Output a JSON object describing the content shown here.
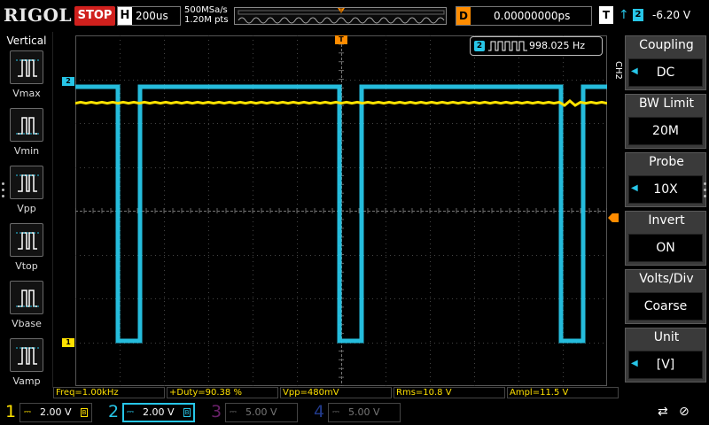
{
  "colors": {
    "ch1": "#ffe100",
    "ch2": "#27c6e8",
    "ch3": "#c03cc0",
    "ch4": "#3d6bff",
    "accent_stop": "#d0201d",
    "trigger_orange": "#ff8c00"
  },
  "topbar": {
    "brand": "RIGOL",
    "status": "STOP",
    "h_label": "H",
    "timebase": "200us",
    "sample_rate": "500MSa/s",
    "mem_depth": "1.20M pts",
    "delay_label": "D",
    "delay_value": "0.00000000ps",
    "trigger_label": "T",
    "trigger_edge_icon": "rising-edge-icon",
    "trigger_source": "2",
    "trigger_level": "-6.20 V"
  },
  "left_panel": {
    "title": "Vertical",
    "items": [
      {
        "label": "Vmax",
        "icon": "vmax-icon"
      },
      {
        "label": "Vmin",
        "icon": "vmin-icon"
      },
      {
        "label": "Vpp",
        "icon": "vpp-icon"
      },
      {
        "label": "Vtop",
        "icon": "vtop-icon"
      },
      {
        "label": "Vbase",
        "icon": "vbase-icon"
      },
      {
        "label": "Vamp",
        "icon": "vamp-icon"
      }
    ]
  },
  "freq_counter": {
    "channel": "2",
    "value": "998.025 Hz"
  },
  "markers": {
    "ch1": "1",
    "ch2": "2",
    "trigger_pos": "T"
  },
  "right_menu": {
    "channel_tag": "CH2",
    "items": [
      {
        "title": "Coupling",
        "value": "DC",
        "has_arrow": true
      },
      {
        "title": "BW Limit",
        "value": "20M",
        "has_arrow": false
      },
      {
        "title": "Probe",
        "value": "10X",
        "has_arrow": true
      },
      {
        "title": "Invert",
        "value": "ON",
        "has_arrow": false
      },
      {
        "title": "Volts/Div",
        "value": "Coarse",
        "has_arrow": false
      },
      {
        "title": "Unit",
        "value": "[V]",
        "has_arrow": true
      }
    ]
  },
  "measurements": [
    "Freq=1.00kHz",
    "+Duty=90.38 %",
    "Vpp=480mV",
    "Rms=10.8 V",
    "Ampl=11.5 V"
  ],
  "channels": [
    {
      "num": "1",
      "scale": "2.00 V",
      "active": true
    },
    {
      "num": "2",
      "scale": "2.00 V",
      "active": true,
      "selected": true
    },
    {
      "num": "3",
      "scale": "5.00 V",
      "active": false
    },
    {
      "num": "4",
      "scale": "5.00 V",
      "active": false
    }
  ],
  "system_icons": [
    "usb-icon",
    "speaker-mute-icon"
  ]
}
